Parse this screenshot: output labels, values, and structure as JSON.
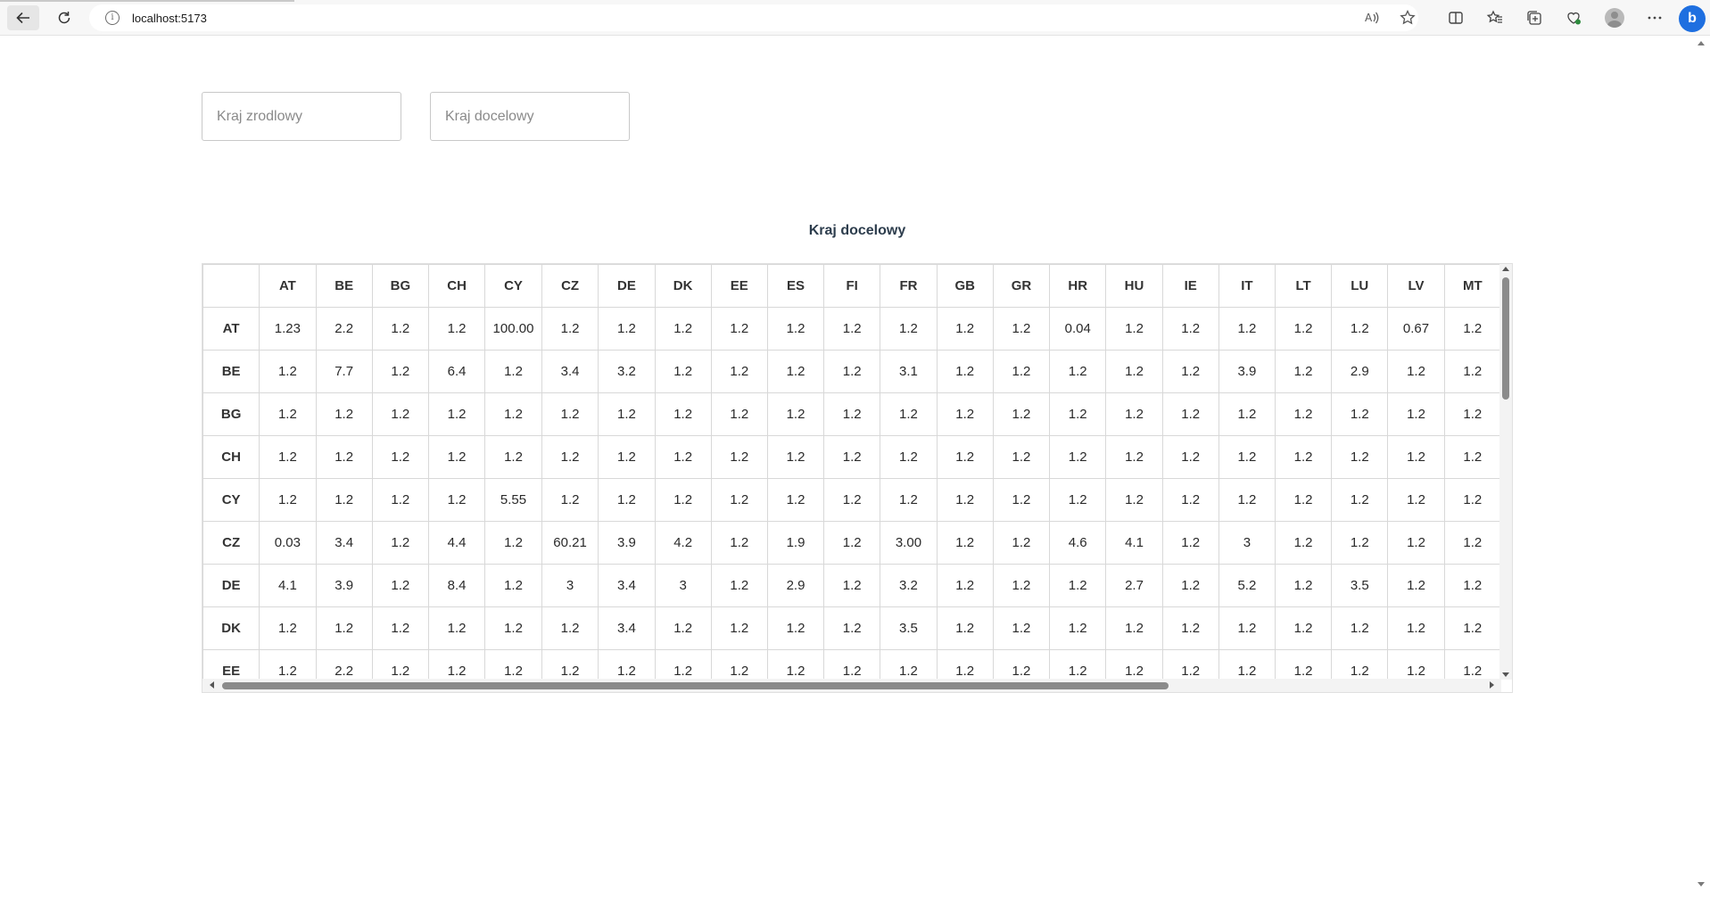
{
  "browser": {
    "url": "localhost:5173"
  },
  "inputs": {
    "source_placeholder": "Kraj zrodlowy",
    "target_placeholder": "Kraj docelowy"
  },
  "table": {
    "title": "Kraj docelowy",
    "columns": [
      "AT",
      "BE",
      "BG",
      "CH",
      "CY",
      "CZ",
      "DE",
      "DK",
      "EE",
      "ES",
      "FI",
      "FR",
      "GB",
      "GR",
      "HR",
      "HU",
      "IE",
      "IT",
      "LT",
      "LU",
      "LV",
      "MT"
    ],
    "rows": [
      {
        "label": "AT",
        "cells": [
          "1.23",
          "2.2",
          "1.2",
          "1.2",
          "100.00",
          "1.2",
          "1.2",
          "1.2",
          "1.2",
          "1.2",
          "1.2",
          "1.2",
          "1.2",
          "1.2",
          "0.04",
          "1.2",
          "1.2",
          "1.2",
          "1.2",
          "1.2",
          "0.67",
          "1.2"
        ]
      },
      {
        "label": "BE",
        "cells": [
          "1.2",
          "7.7",
          "1.2",
          "6.4",
          "1.2",
          "3.4",
          "3.2",
          "1.2",
          "1.2",
          "1.2",
          "1.2",
          "3.1",
          "1.2",
          "1.2",
          "1.2",
          "1.2",
          "1.2",
          "3.9",
          "1.2",
          "2.9",
          "1.2",
          "1.2"
        ]
      },
      {
        "label": "BG",
        "cells": [
          "1.2",
          "1.2",
          "1.2",
          "1.2",
          "1.2",
          "1.2",
          "1.2",
          "1.2",
          "1.2",
          "1.2",
          "1.2",
          "1.2",
          "1.2",
          "1.2",
          "1.2",
          "1.2",
          "1.2",
          "1.2",
          "1.2",
          "1.2",
          "1.2",
          "1.2"
        ]
      },
      {
        "label": "CH",
        "cells": [
          "1.2",
          "1.2",
          "1.2",
          "1.2",
          "1.2",
          "1.2",
          "1.2",
          "1.2",
          "1.2",
          "1.2",
          "1.2",
          "1.2",
          "1.2",
          "1.2",
          "1.2",
          "1.2",
          "1.2",
          "1.2",
          "1.2",
          "1.2",
          "1.2",
          "1.2"
        ]
      },
      {
        "label": "CY",
        "cells": [
          "1.2",
          "1.2",
          "1.2",
          "1.2",
          "5.55",
          "1.2",
          "1.2",
          "1.2",
          "1.2",
          "1.2",
          "1.2",
          "1.2",
          "1.2",
          "1.2",
          "1.2",
          "1.2",
          "1.2",
          "1.2",
          "1.2",
          "1.2",
          "1.2",
          "1.2"
        ]
      },
      {
        "label": "CZ",
        "cells": [
          "0.03",
          "3.4",
          "1.2",
          "4.4",
          "1.2",
          "60.21",
          "3.9",
          "4.2",
          "1.2",
          "1.9",
          "1.2",
          "3.00",
          "1.2",
          "1.2",
          "4.6",
          "4.1",
          "1.2",
          "3",
          "1.2",
          "1.2",
          "1.2",
          "1.2"
        ]
      },
      {
        "label": "DE",
        "cells": [
          "4.1",
          "3.9",
          "1.2",
          "8.4",
          "1.2",
          "3",
          "3.4",
          "3",
          "1.2",
          "2.9",
          "1.2",
          "3.2",
          "1.2",
          "1.2",
          "1.2",
          "2.7",
          "1.2",
          "5.2",
          "1.2",
          "3.5",
          "1.2",
          "1.2"
        ]
      },
      {
        "label": "DK",
        "cells": [
          "1.2",
          "1.2",
          "1.2",
          "1.2",
          "1.2",
          "1.2",
          "3.4",
          "1.2",
          "1.2",
          "1.2",
          "1.2",
          "3.5",
          "1.2",
          "1.2",
          "1.2",
          "1.2",
          "1.2",
          "1.2",
          "1.2",
          "1.2",
          "1.2",
          "1.2"
        ]
      },
      {
        "label": "EE",
        "cells": [
          "1.2",
          "2.2",
          "1.2",
          "1.2",
          "1.2",
          "1.2",
          "1.2",
          "1.2",
          "1.2",
          "1.2",
          "1.2",
          "1.2",
          "1.2",
          "1.2",
          "1.2",
          "1.2",
          "1.2",
          "1.2",
          "1.2",
          "1.2",
          "1.2",
          "1.2"
        ]
      }
    ]
  }
}
